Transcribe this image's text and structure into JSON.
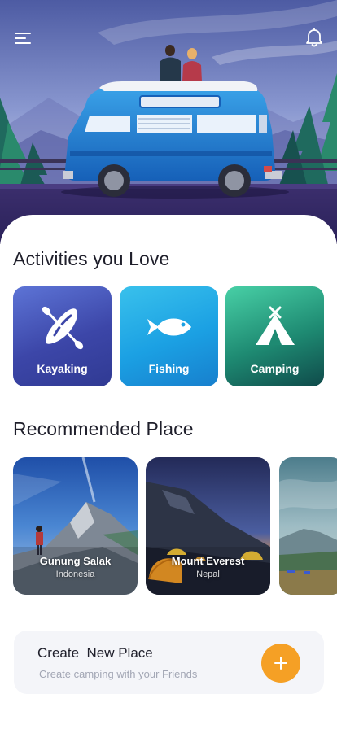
{
  "header": {
    "menu_icon": "hamburger-menu-icon",
    "notification_icon": "bell-icon"
  },
  "activities": {
    "title": "Activities you Love",
    "items": [
      {
        "label": "Kayaking",
        "icon": "kayak-icon"
      },
      {
        "label": "Fishing",
        "icon": "fish-icon"
      },
      {
        "label": "Camping",
        "icon": "tent-icon"
      }
    ]
  },
  "recommended": {
    "title": "Recommended Place",
    "places": [
      {
        "name": "Gunung Salak",
        "location": "Indonesia"
      },
      {
        "name": "Mount Everest",
        "location": "Nepal"
      },
      {
        "name": "",
        "location": ""
      }
    ]
  },
  "create_place": {
    "title": "Create  New Place",
    "subtitle": "Create camping with your Friends",
    "button_icon": "plus-icon"
  },
  "colors": {
    "accent_orange": "#f5a025",
    "kayaking_card": "#3c46a8",
    "fishing_card": "#1ba0e3",
    "camping_card": "#1e8a72",
    "text_dark": "#1f1f2b"
  }
}
